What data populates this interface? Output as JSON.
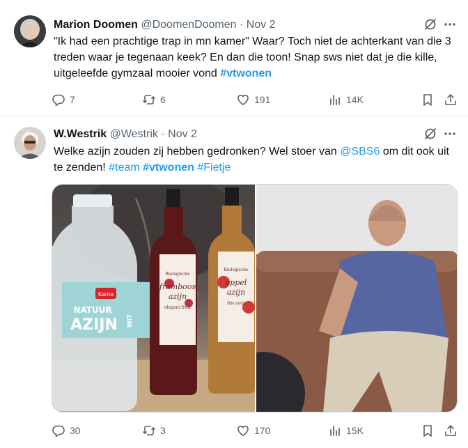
{
  "tweets": [
    {
      "author": {
        "name": "Marion Doomen",
        "handle": "@DoomenDoomen",
        "date": "Nov 2"
      },
      "text_parts": [
        "\"Ik had een prachtige trap in mn kamer\" Waar? Toch niet de achterkant van die 3 treden waar je tegenaan keek? En dan die toon! Snap sws niet dat je die kille, uitgeleefde gymzaal mooier vond ",
        "#vtwonen"
      ],
      "stats": {
        "replies": "7",
        "reposts": "6",
        "likes": "191",
        "views": "14K"
      }
    },
    {
      "author": {
        "name": "W.Westrik",
        "handle": "@Westrik",
        "date": "Nov 2"
      },
      "text_parts": [
        "Welke azijn zouden zij hebben gedronken? Wel stoer van ",
        "@SBS6",
        " om dit ook uit te zenden! ",
        "#team",
        " ",
        "#vtwonen",
        " ",
        "#Fietje"
      ],
      "media": {
        "left_image": {
          "bottle_label": {
            "line1": "NATUUR",
            "line2": "AZIJN",
            "side": "WIT",
            "brand": "Kania"
          },
          "small_bottles": [
            {
              "label_top": "Biologische",
              "label_mid": "framboos",
              "label_bottom": "azijn",
              "label_foot": "elegant fruit"
            },
            {
              "label_top": "Biologische",
              "label_mid": "appel",
              "label_bottom": "azijn",
              "label_foot": "fris zuur"
            }
          ]
        },
        "right_image": {
          "description_icon": "person-on-sofa-photo"
        }
      },
      "stats": {
        "replies": "30",
        "reposts": "3",
        "likes": "170",
        "views": "15K"
      }
    }
  ],
  "separator": "·",
  "colors": {
    "link": "#1d9bf0",
    "muted": "#536471",
    "text": "#0f1419"
  }
}
